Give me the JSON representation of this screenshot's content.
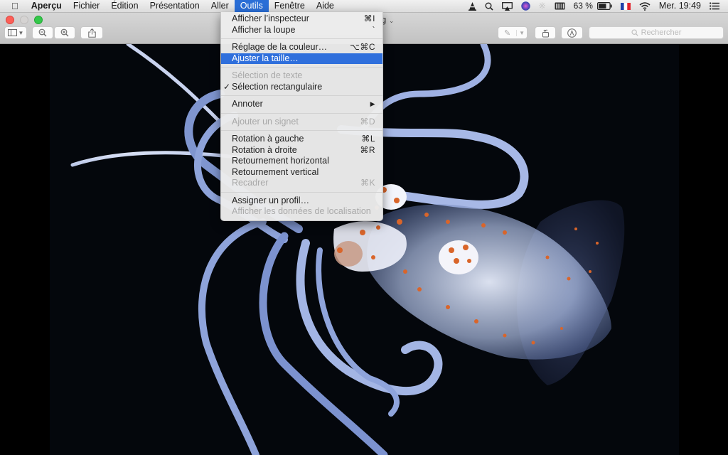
{
  "menubar": {
    "apple_icon": "apple-logo-icon",
    "app_name": "Aperçu",
    "menus": [
      "Fichier",
      "Édition",
      "Présentation",
      "Aller",
      "Outils",
      "Fenêtre",
      "Aide"
    ],
    "active_menu": "Outils",
    "status": {
      "battery_percent": "63 %",
      "clock": "Mer. 19:49",
      "icons": [
        "vlc-icon",
        "spotlight-search-icon",
        "airplay-icon",
        "siri-icon",
        "bluetooth-icon",
        "memory-icon",
        "battery-icon",
        "flag-fr-icon",
        "wifi-icon",
        "notification-center-icon"
      ]
    }
  },
  "window": {
    "title_fragment": "g",
    "toolbar": {
      "sidebar_toggle": "sidebar-icon",
      "zoom_out": "zoom-out-icon",
      "zoom_in": "zoom-in-icon",
      "share": "share-icon",
      "markup_pen": "pen-icon",
      "rotate": "rotate-icon",
      "markup_toolbar": "markup-icon",
      "search_placeholder": "Rechercher"
    }
  },
  "tools_menu": {
    "items": [
      {
        "label": "Afficher l’inspecteur",
        "shortcut": "⌘I",
        "enabled": true
      },
      {
        "label": "Afficher la loupe",
        "shortcut": "`",
        "enabled": true
      },
      {
        "separator": true
      },
      {
        "label": "Réglage de la couleur…",
        "shortcut": "⌥⌘C",
        "enabled": true
      },
      {
        "label": "Ajuster la taille…",
        "shortcut": "",
        "enabled": true,
        "highlighted": true
      },
      {
        "separator": true
      },
      {
        "label": "Sélection de texte",
        "shortcut": "",
        "enabled": false
      },
      {
        "label": "Sélection rectangulaire",
        "shortcut": "",
        "enabled": true,
        "checked": true
      },
      {
        "separator": true
      },
      {
        "label": "Annoter",
        "shortcut": "▶",
        "enabled": true,
        "submenu": true
      },
      {
        "separator": true
      },
      {
        "label": "Ajouter un signet",
        "shortcut": "⌘D",
        "enabled": false
      },
      {
        "separator": true
      },
      {
        "label": "Rotation à gauche",
        "shortcut": "⌘L",
        "enabled": true
      },
      {
        "label": "Rotation à droite",
        "shortcut": "⌘R",
        "enabled": true
      },
      {
        "label": "Retournement horizontal",
        "shortcut": "",
        "enabled": true
      },
      {
        "label": "Retournement vertical",
        "shortcut": "",
        "enabled": true
      },
      {
        "label": "Recadrer",
        "shortcut": "⌘K",
        "enabled": false
      },
      {
        "separator": true
      },
      {
        "label": "Assigner un profil…",
        "shortcut": "",
        "enabled": true
      },
      {
        "label": "Afficher les données de localisation",
        "shortcut": "",
        "enabled": false
      }
    ]
  },
  "document": {
    "subject": "glass squid photograph",
    "colors": {
      "background": "#04070c",
      "body": "#c9d6f2",
      "spots": "#d9652a"
    }
  }
}
